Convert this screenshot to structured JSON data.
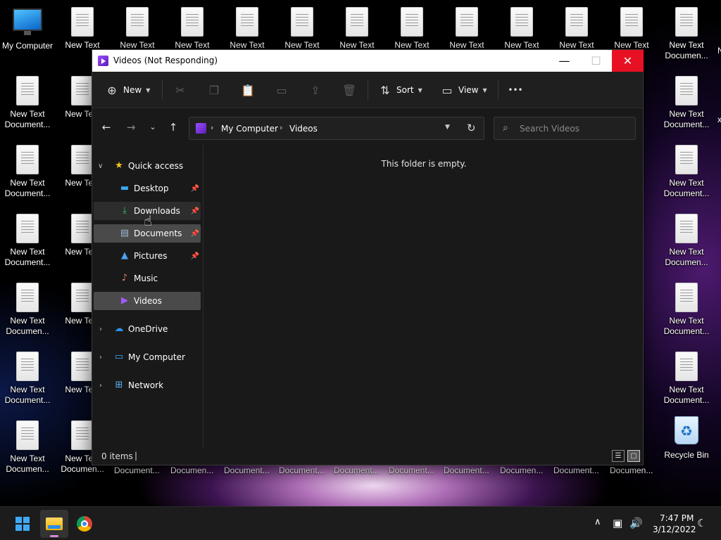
{
  "desktop": {
    "icons": [
      {
        "label1": "My Computer",
        "label2": "",
        "type": "computer"
      },
      {
        "label1": "New Text",
        "label2": "Document...",
        "type": "doc"
      },
      {
        "label1": "Recycle Bin",
        "label2": "",
        "type": "bin"
      }
    ],
    "doc_label1": "New Text",
    "doc_label2": "Document...",
    "doc_label2_alt": "Documen...",
    "partial_text": "xt",
    "partial_text2": "nt..."
  },
  "window": {
    "title": "Videos (Not Responding)",
    "controls": {
      "minimize": "—",
      "maximize": "☐",
      "close": "✕"
    }
  },
  "toolbar": {
    "new_label": "New",
    "sort_label": "Sort",
    "view_label": "View",
    "more_label": "•••"
  },
  "address": {
    "crumbs": [
      "My Computer",
      "Videos"
    ],
    "search_placeholder": "Search Videos"
  },
  "navpane": {
    "quick_access": "Quick access",
    "items": [
      {
        "label": "Desktop",
        "pinned": true
      },
      {
        "label": "Downloads",
        "pinned": true
      },
      {
        "label": "Documents",
        "pinned": true
      },
      {
        "label": "Pictures",
        "pinned": true
      },
      {
        "label": "Music",
        "pinned": false
      },
      {
        "label": "Videos",
        "pinned": false
      }
    ],
    "roots": [
      {
        "label": "OneDrive"
      },
      {
        "label": "My Computer"
      },
      {
        "label": "Network"
      }
    ]
  },
  "content": {
    "empty_message": "This folder is empty."
  },
  "statusbar": {
    "count": "0 items",
    "separator": "|"
  },
  "taskbar": {
    "time": "7:47 PM",
    "date": "3/12/2022"
  },
  "colors": {
    "close_button": "#e81123",
    "selected_row": "#4a4a4a",
    "accent_purple": "#8b3dff"
  }
}
